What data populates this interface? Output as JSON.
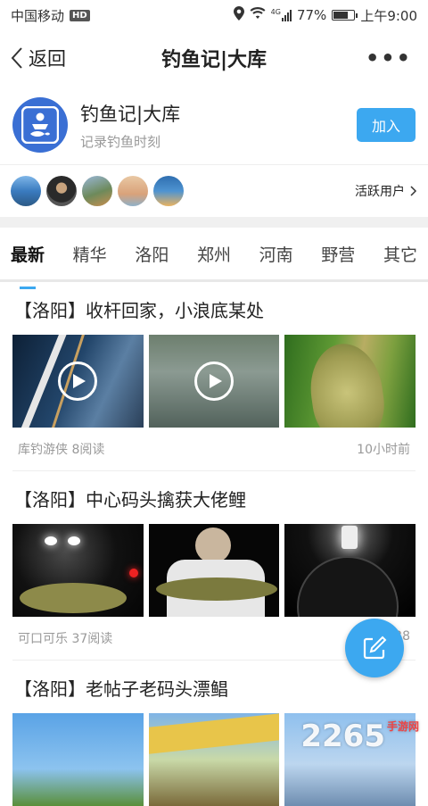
{
  "status": {
    "carrier": "中国移动",
    "hd": "HD",
    "network": "4G",
    "battery": "77%",
    "battery_level": 0.77,
    "time": "上午9:00"
  },
  "nav": {
    "back_label": "返回",
    "title": "钓鱼记|大库",
    "more_label": "•••"
  },
  "group": {
    "name": "钓鱼记|大库",
    "subtitle": "记录钓鱼时刻",
    "join_label": "加入"
  },
  "active_users": {
    "label": "活跃用户"
  },
  "tabs": [
    "最新",
    "精华",
    "洛阳",
    "郑州",
    "河南",
    "野营",
    "其它"
  ],
  "posts": [
    {
      "title": "【洛阳】收杆回家，小浪底某处",
      "author_reads": "库钓游侠 8阅读",
      "time": "10小时前"
    },
    {
      "title": "【洛阳】中心码头擒获大佬鲤",
      "author_reads": "可口可乐 37阅读",
      "time": "38"
    },
    {
      "title": "【洛阳】老帖子老码头漂鲳"
    }
  ],
  "watermark": {
    "text": "2265",
    "sub": "手游网"
  }
}
